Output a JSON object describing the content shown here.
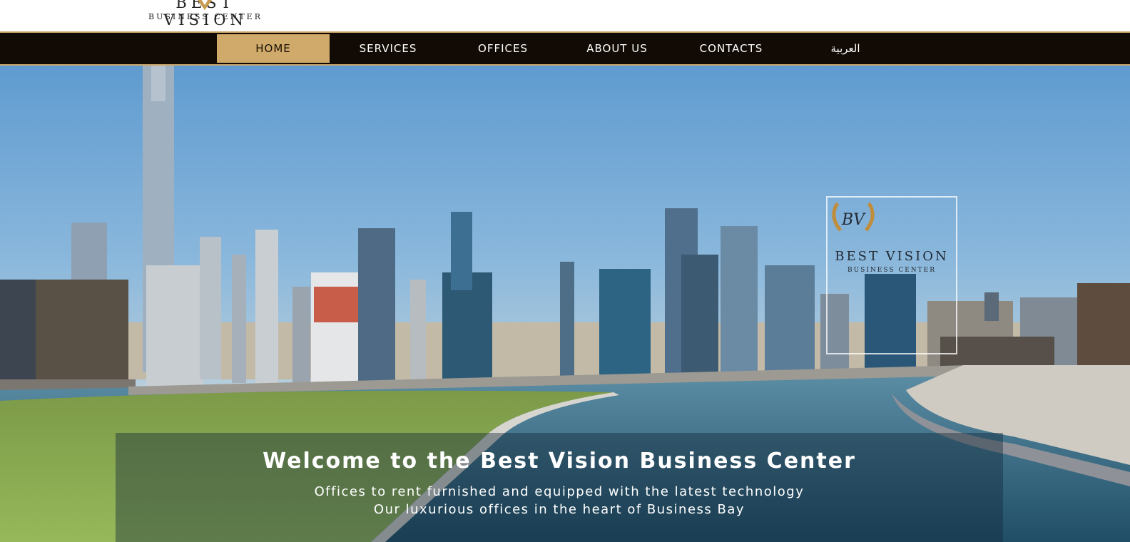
{
  "header": {
    "logo_name": "BEST VISION",
    "logo_sub": "BUSINESS CENTER"
  },
  "nav": {
    "items": [
      {
        "label": "HOME",
        "active": true
      },
      {
        "label": "SERVICES",
        "active": false
      },
      {
        "label": "OFFICES",
        "active": false
      },
      {
        "label": "ABOUT US",
        "active": false
      },
      {
        "label": "CONTACTS",
        "active": false
      },
      {
        "label": "العربية",
        "active": false
      }
    ]
  },
  "hero": {
    "logo_name": "BEST VISION",
    "logo_sub": "BUSINESS CENTER",
    "logo_monogram": "BV",
    "welcome_title": "Welcome to the Best Vision Business Center",
    "welcome_line1": "Offices to rent furnished and equipped with the latest technology",
    "welcome_line2": "Our luxurious offices in the heart of Business Bay"
  },
  "colors": {
    "nav_bg": "#120b05",
    "accent_gold": "#d0aa6a",
    "sky": "#6ea3cf",
    "water": "#2f6a84",
    "grass": "#7fa04a"
  },
  "icons": [
    "logo-v-mark-icon",
    "laurel-monogram-icon"
  ]
}
